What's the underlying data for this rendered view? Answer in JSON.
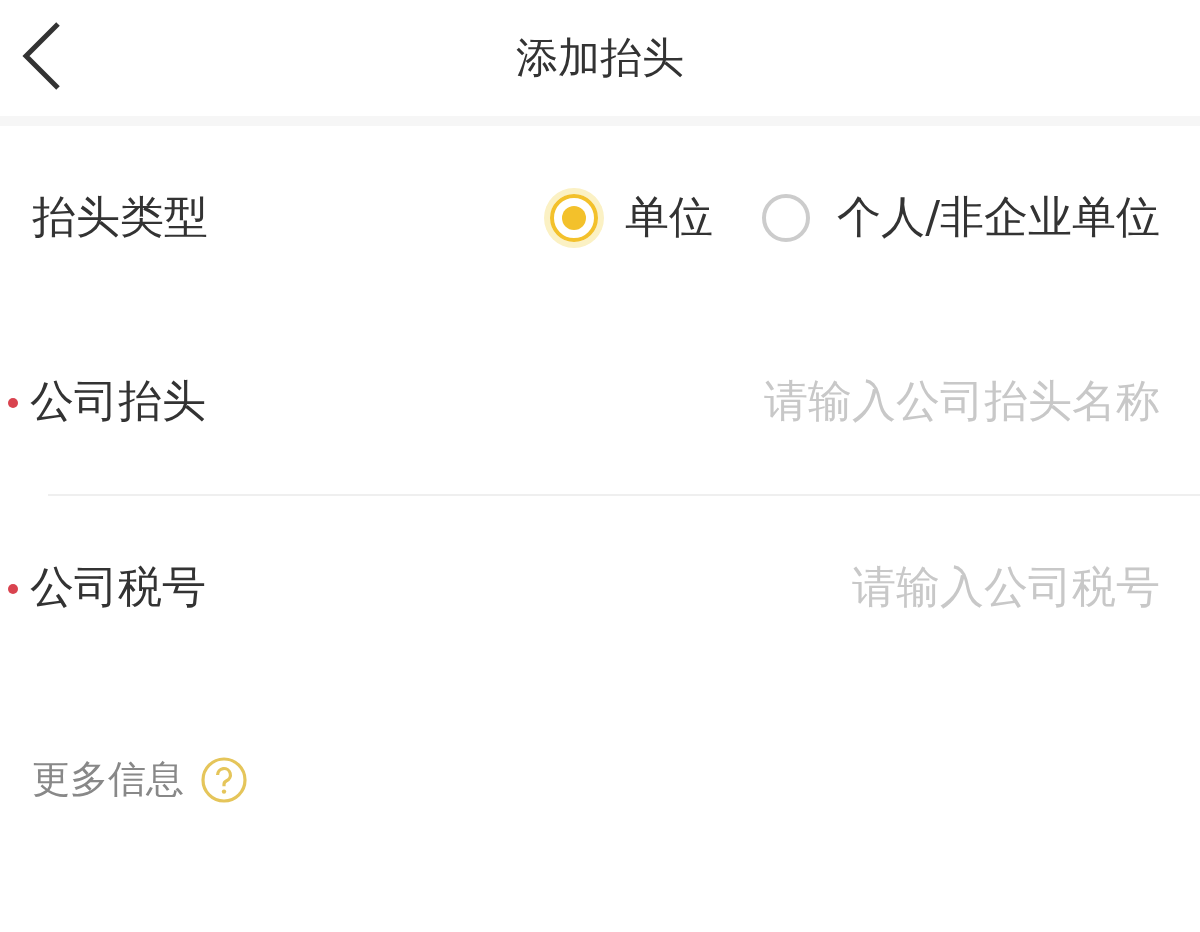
{
  "header": {
    "title": "添加抬头"
  },
  "title_type": {
    "label": "抬头类型",
    "options": [
      {
        "label": "单位",
        "selected": true
      },
      {
        "label": "个人/非企业单位",
        "selected": false
      }
    ]
  },
  "fields": [
    {
      "label": "公司抬头",
      "required": true,
      "placeholder": "请输入公司抬头名称"
    },
    {
      "label": "公司税号",
      "required": true,
      "placeholder": "请输入公司税号"
    }
  ],
  "more_info": {
    "label": "更多信息"
  }
}
